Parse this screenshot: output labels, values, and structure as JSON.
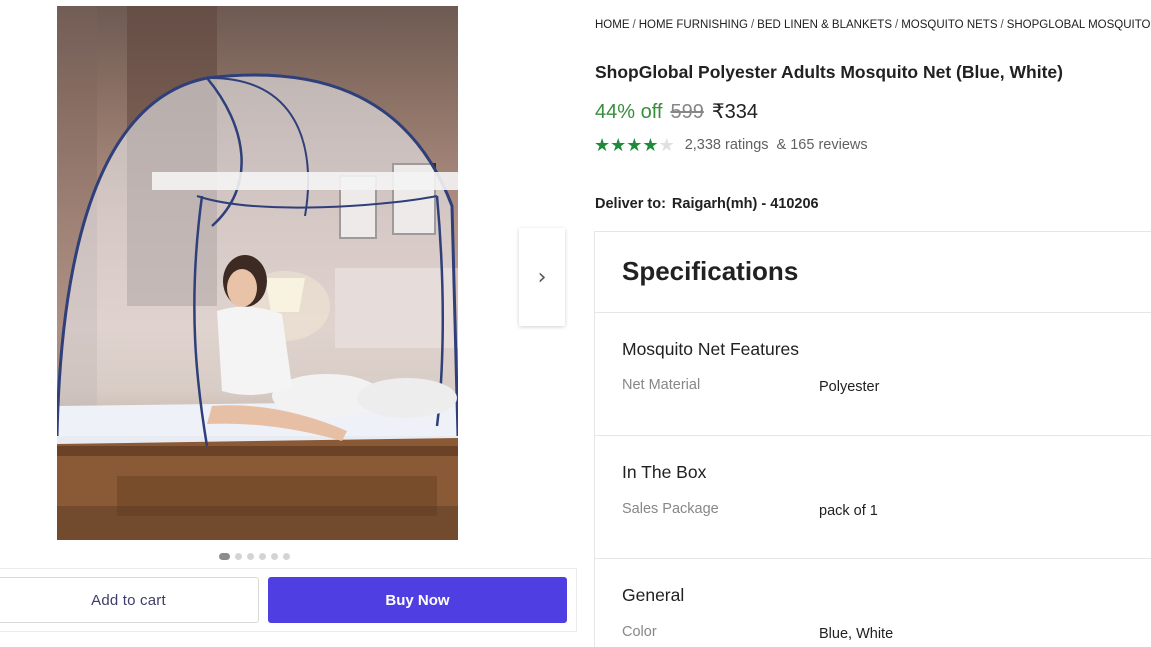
{
  "gallery": {
    "image_alt": "ShopGlobal Polyester Adults Mosquito Net (Blue, White)",
    "next_icon": "chevron-right-icon",
    "next_glyph": "›",
    "dots_count": 6,
    "active_dot": 0
  },
  "actions": {
    "add_to_cart": "Add to cart",
    "buy_now": "Buy Now"
  },
  "breadcrumb": [
    "HOME",
    "HOME FURNISHING",
    "BED LINEN & BLANKETS",
    "MOSQUITO NETS",
    "SHOPGLOBAL MOSQUITO NET"
  ],
  "product": {
    "title": "ShopGlobal Polyester Adults Mosquito Net (Blue, White)",
    "discount": "44% off",
    "mrp": "599",
    "price": "₹334",
    "rating": 4,
    "ratings_text": "2,338 ratings",
    "reviews_text": "& 165 reviews"
  },
  "delivery": {
    "label": "Deliver to:",
    "location": "Raigarh(mh) - 410206"
  },
  "specifications": {
    "heading": "Specifications",
    "groups": [
      {
        "title": "Mosquito Net Features",
        "key": "Net Material",
        "value": "Polyester"
      },
      {
        "title": "In The Box",
        "key": "Sales Package",
        "value": "pack of 1"
      },
      {
        "title": "General",
        "key": "Color",
        "value": "Blue, White"
      }
    ]
  },
  "colors": {
    "discount_green": "#388e3c",
    "star_green": "#1e8a3b",
    "buy_button": "#4f3fe3"
  }
}
